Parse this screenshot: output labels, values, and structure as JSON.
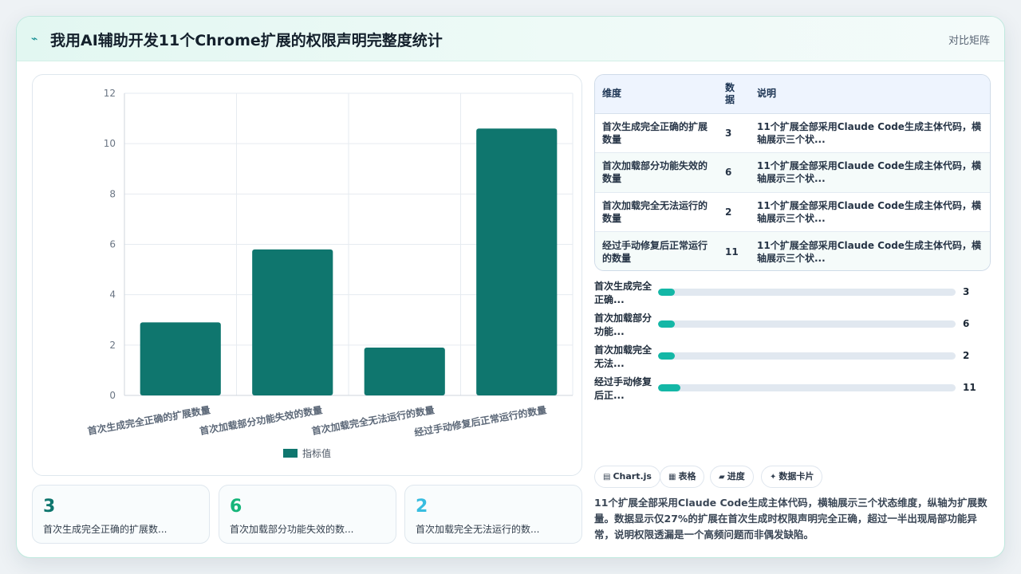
{
  "header": {
    "icon": "lightning-icon",
    "title": "我用AI辅助开发11个Chrome扩展的权限声明完整度统计",
    "matrix_link": "对比矩阵"
  },
  "colors": {
    "bar": "#0f766e",
    "accent": "#14b7a6",
    "kpi_colors": [
      "#0f766e",
      "#16b57a",
      "#38bde0"
    ]
  },
  "chart_data": {
    "type": "bar",
    "categories": [
      "首次生成完全正确的扩展数量",
      "首次加载部分功能失效的数量",
      "首次加载完全无法运行的数量",
      "经过手动修复后正常运行的数量"
    ],
    "series": [
      {
        "name": "指标值",
        "values": [
          2.9,
          5.8,
          1.9,
          10.6
        ]
      }
    ],
    "ylim": [
      0,
      12
    ],
    "yticks": [
      0,
      2,
      4,
      6,
      8,
      10,
      12
    ],
    "grid": true,
    "legend": "bottom"
  },
  "kpis": [
    {
      "value": "3",
      "label": "首次生成完全正确的扩展数..."
    },
    {
      "value": "6",
      "label": "首次加载部分功能失效的数..."
    },
    {
      "value": "2",
      "label": "首次加载完全无法运行的数..."
    }
  ],
  "table": {
    "headers": [
      "维度",
      "数据",
      "说明"
    ],
    "rows": [
      {
        "dim": "首次生成完全正确的扩展数量",
        "val": "3",
        "desc": "11个扩展全部采用Claude Code生成主体代码，横轴展示三个状..."
      },
      {
        "dim": "首次加载部分功能失效的数量",
        "val": "6",
        "desc": "11个扩展全部采用Claude Code生成主体代码，横轴展示三个状..."
      },
      {
        "dim": "首次加载完全无法运行的数量",
        "val": "2",
        "desc": "11个扩展全部采用Claude Code生成主体代码，横轴展示三个状..."
      },
      {
        "dim": "经过手动修复后正常运行的数量",
        "val": "11",
        "desc": "11个扩展全部采用Claude Code生成主体代码，横轴展示三个状..."
      }
    ]
  },
  "progress": [
    {
      "label": "首次生成完全正确...",
      "value": "3",
      "fraction": 0.055
    },
    {
      "label": "首次加载部分功能...",
      "value": "6",
      "fraction": 0.055
    },
    {
      "label": "首次加载完全无法...",
      "value": "2",
      "fraction": 0.055
    },
    {
      "label": "经过手动修复后正...",
      "value": "11",
      "fraction": 0.075
    }
  ],
  "chips": [
    {
      "icon": "chart-icon",
      "glyph": "▤",
      "label": "Chart.js"
    },
    {
      "icon": "table-icon",
      "glyph": "▦",
      "label": "表格"
    },
    {
      "icon": "progress-icon",
      "glyph": "▰",
      "label": "进度"
    },
    {
      "icon": "sparkle-icon",
      "glyph": "✦",
      "label": "数据卡片"
    }
  ],
  "summary": "11个扩展全部采用Claude Code生成主体代码，横轴展示三个状态维度，纵轴为扩展数量。数据显示仅27%的扩展在首次生成时权限声明完全正确，超过一半出现局部功能异常，说明权限透漏是一个高频问题而非偶发缺陷。"
}
